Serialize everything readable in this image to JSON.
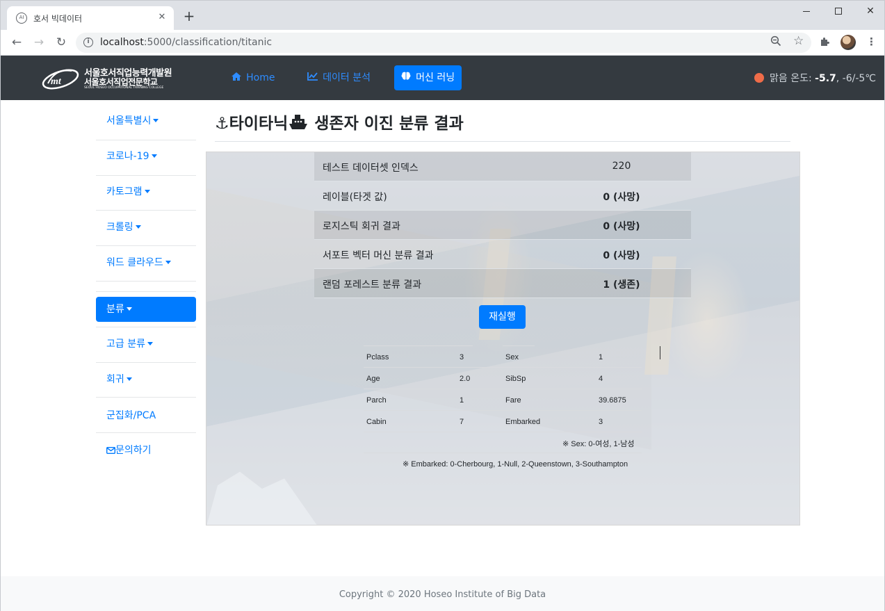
{
  "browser": {
    "tab_title": "호서 빅데이터",
    "favicon_text": "AI",
    "url_host": "localhost",
    "url_path": ":5000/classification/titanic"
  },
  "navbar": {
    "logo": {
      "line1": "서울호서직업능력개발원",
      "line2": "서울호서직업전문학교",
      "line3": "SEOUL HOSEO OCCUPATIONAL TRAINING COLLEGE"
    },
    "links": [
      {
        "label": "Home",
        "icon": "home-icon"
      },
      {
        "label": "데이터 분석",
        "icon": "chart-icon"
      },
      {
        "label": "머신 러닝",
        "icon": "brain-icon",
        "active": true
      }
    ],
    "weather": {
      "label": "맑음 온도:",
      "current": "-5.7",
      "range": ", -6/-5℃",
      "indicator_color": "#ef6c49"
    }
  },
  "sidebar": {
    "items": [
      {
        "label": "서울특별시",
        "dropdown": true
      },
      {
        "label": "코로나-19",
        "dropdown": true
      },
      {
        "label": "카토그램",
        "dropdown": true
      },
      {
        "label": "크롤링",
        "dropdown": true
      },
      {
        "label": "워드 클라우드",
        "dropdown": true
      },
      {
        "label": "분류",
        "dropdown": true,
        "active": true
      },
      {
        "label": "고급 분류",
        "dropdown": true
      },
      {
        "label": "회귀",
        "dropdown": true
      },
      {
        "label": "군집화/PCA",
        "dropdown": false
      },
      {
        "label": "문의하기",
        "dropdown": false,
        "icon": "envelope-icon"
      }
    ]
  },
  "main": {
    "title_prefix": "⚓",
    "title_part1": "타이타닉",
    "title_ship": "🚢",
    "title_part2": " 생존자 이진 분류 결과",
    "results": [
      {
        "label": "테스트 데이터셋 인덱스",
        "value": "220",
        "bold": false
      },
      {
        "label": "레이블(타겟 값)",
        "value": "0 (사망)",
        "bold": true
      },
      {
        "label": "로지스틱 회귀 결과",
        "value": "0 (사망)",
        "bold": true
      },
      {
        "label": "서포트 벡터 머신 분류 결과",
        "value": "0 (사망)",
        "bold": true
      },
      {
        "label": "랜덤 포레스트 분류 결과",
        "value": "1 (생존)",
        "bold": true
      }
    ],
    "rerun_label": "재실행",
    "features": [
      {
        "name1": "Pclass",
        "value1": "3",
        "name2": "Sex",
        "value2": "1"
      },
      {
        "name1": "Age",
        "value1": "2.0",
        "name2": "SibSp",
        "value2": "4"
      },
      {
        "name1": "Parch",
        "value1": "1",
        "name2": "Fare",
        "value2": "39.6875"
      },
      {
        "name1": "Cabin",
        "value1": "7",
        "name2": "Embarked",
        "value2": "3"
      }
    ],
    "note_sex": "※ Sex: 0-여성, 1-남성",
    "note_embarked": "※ Embarked: 0-Cherbourg, 1-Null, 2-Queenstown, 3-Southampton"
  },
  "footer": {
    "copyright": "Copyright © 2020 Hoseo Institute of Big Data"
  }
}
